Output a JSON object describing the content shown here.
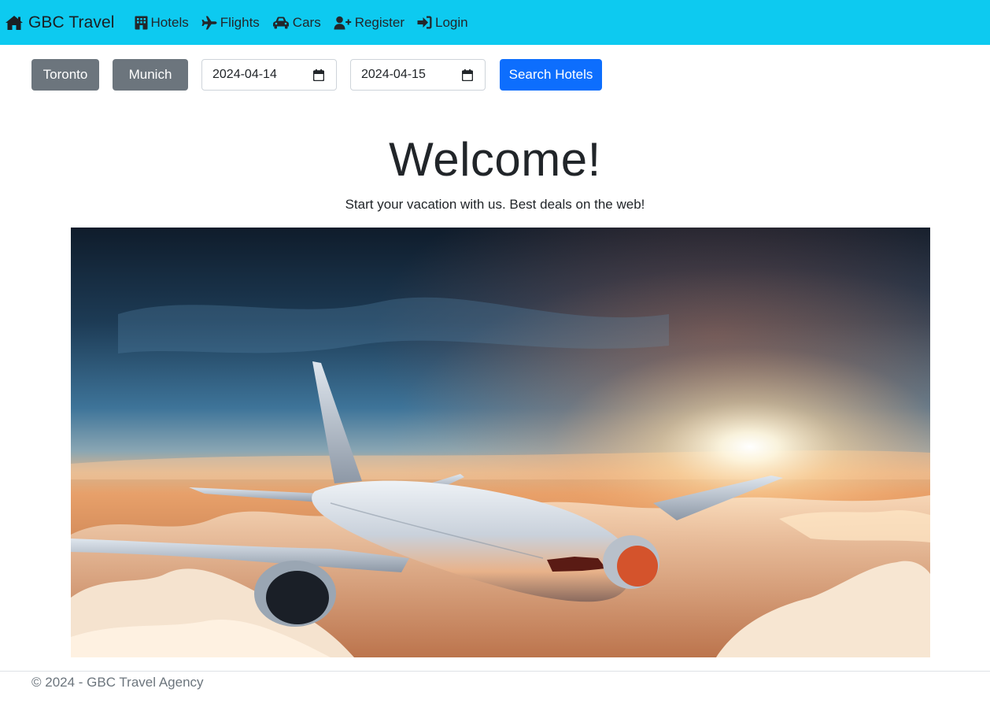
{
  "navbar": {
    "background": "#0dcaf0",
    "brand": {
      "label": "GBC Travel",
      "icon": "home-icon"
    },
    "items": [
      {
        "label": "Hotels",
        "icon": "hotel-icon"
      },
      {
        "label": "Flights",
        "icon": "plane-icon"
      },
      {
        "label": "Cars",
        "icon": "car-icon"
      },
      {
        "label": "Register",
        "icon": "user-plus-icon"
      },
      {
        "label": "Login",
        "icon": "sign-in-icon"
      }
    ]
  },
  "search": {
    "origin": "Toronto",
    "destination": "Munich",
    "check_in": "2024-04-14",
    "check_out": "2024-04-15",
    "submit_label": "Search Hotels",
    "primary_color": "#0d6efd",
    "secondary_color": "#6c757d"
  },
  "hero": {
    "title": "Welcome!",
    "tagline": "Start your vacation with us. Best deals on the web!",
    "image": "airplane-flying-above-clouds-at-sunset"
  },
  "footer": {
    "text": "© 2024 - GBC Travel Agency"
  }
}
